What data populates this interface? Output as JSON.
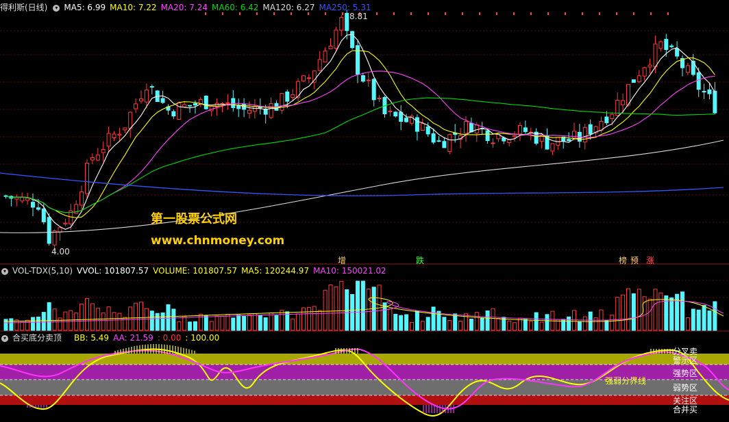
{
  "main_panel": {
    "title": "得利斯(日线)",
    "indicators": [
      {
        "label": "MA5: 6.99",
        "color": "#ffffff"
      },
      {
        "label": "MA10: 7.22",
        "color": "#ffff00"
      },
      {
        "label": "MA20: 7.24",
        "color": "#ff44ff"
      },
      {
        "label": "MA60: 6.42",
        "color": "#00dd00"
      },
      {
        "label": "MA120: 6.27",
        "color": "#dddddd"
      },
      {
        "label": "MA250: 5.31",
        "color": "#3355ff"
      }
    ],
    "high_label": "8.81",
    "low_label": "4.00",
    "watermark_cn": "第一股票公式网",
    "watermark_url": "www.chnmoney.com",
    "signals": [
      {
        "text": "增",
        "color": "#ffcc66"
      },
      {
        "text": "跌",
        "color": "#33ff33"
      },
      {
        "text": "榜",
        "color": "#ffcc66"
      },
      {
        "text": "预",
        "color": "#ffcc66"
      },
      {
        "text": "涨",
        "color": "#ff5555"
      }
    ]
  },
  "volume_panel": {
    "title": "VOL-TDX(5,10)",
    "indicators": [
      {
        "label": "VVOL: 101807.57",
        "color": "#ffffff"
      },
      {
        "label": "VOLUME: 101807.57",
        "color": "#ffff00"
      },
      {
        "label": "MA5: 120244.97",
        "color": "#ffff00"
      },
      {
        "label": "MA10: 150021.02",
        "color": "#ff44ff"
      }
    ]
  },
  "indicator_panel": {
    "title": "合买底分卖顶",
    "indicators": [
      {
        "label": "BB: 5.49",
        "color": "#ffff00"
      },
      {
        "label": "AA: 21.59",
        "color": "#ff44ff"
      },
      {
        "label": ": 0.00",
        "color": "#ff3333"
      },
      {
        "label": ": 100.00",
        "color": "#ffff00"
      }
    ],
    "divider_label": "强弱分界线",
    "zones": [
      "分叉卖",
      "警示区",
      "强势区",
      "弱势区",
      "关注区",
      "合并买"
    ]
  },
  "chart_data": {
    "type": "candlestick",
    "price_range": [
      4.0,
      8.81
    ],
    "max_price_label": 8.81,
    "min_price_label": 4.0,
    "ma_last": {
      "MA5": 6.99,
      "MA10": 7.22,
      "MA20": 7.24,
      "MA60": 6.42,
      "MA120": 6.27,
      "MA250": 5.31
    },
    "volume_last": {
      "VVOL": 101807.57,
      "VOLUME": 101807.57,
      "MA5": 120244.97,
      "MA10": 150021.02
    },
    "indicator_last": {
      "BB": 5.49,
      "AA": 21.59,
      "lower": 0.0,
      "upper": 100.0
    }
  }
}
